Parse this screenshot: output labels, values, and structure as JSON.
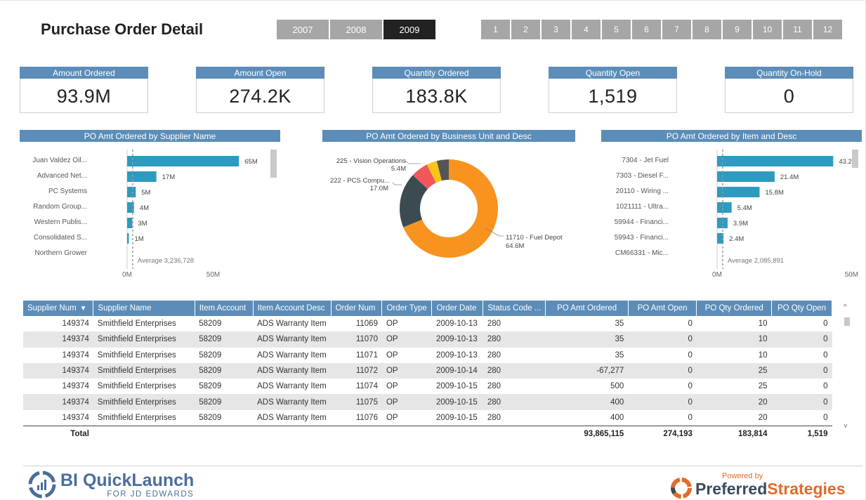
{
  "title": "Purchase Order Detail",
  "years": [
    {
      "label": "2007",
      "selected": false
    },
    {
      "label": "2008",
      "selected": false
    },
    {
      "label": "2009",
      "selected": true
    }
  ],
  "months": [
    "1",
    "2",
    "3",
    "4",
    "5",
    "6",
    "7",
    "8",
    "9",
    "10",
    "11",
    "12"
  ],
  "cards": [
    {
      "label": "Amount Ordered",
      "value": "93.9M"
    },
    {
      "label": "Amount Open",
      "value": "274.2K"
    },
    {
      "label": "Quantity Ordered",
      "value": "183.8K"
    },
    {
      "label": "Quantity Open",
      "value": "1,519"
    },
    {
      "label": "Quantity On-Hold",
      "value": "0"
    }
  ],
  "colors": {
    "header_blue": "#5b8db8",
    "bar_teal": "#2e9ac0",
    "donut_orange": "#f7931e",
    "donut_dark": "#3c4b52",
    "donut_red": "#f0565a",
    "donut_yellow": "#f5c518",
    "donut_grey": "#555555"
  },
  "chart_data": [
    {
      "type": "bar",
      "title": "PO Amt Ordered by Supplier Name",
      "orientation": "horizontal",
      "categories": [
        "Juan Valdez Oil...",
        "Advanced Net...",
        "PC Systems",
        "Random Group...",
        "Western Publis...",
        "Consolidated S...",
        "Northern Grower"
      ],
      "values": [
        65,
        17,
        5,
        4,
        3,
        1,
        0
      ],
      "value_labels": [
        "65M",
        "17M",
        "5M",
        "4M",
        "3M",
        "1M",
        ""
      ],
      "xticks": [
        "0M",
        "50M"
      ],
      "xlim": [
        0,
        80
      ],
      "average_label": "Average 3,236,728",
      "average_value": 3.236728
    },
    {
      "type": "pie",
      "title": "PO Amt Ordered by Business Unit and Desc",
      "slices": [
        {
          "label": "11710 - Fuel Depot",
          "value": 64.6,
          "value_label": "64.6M",
          "color": "#f7931e"
        },
        {
          "label": "222 - PCS Compu...",
          "value": 17.0,
          "value_label": "17.0M",
          "color": "#3c4b52"
        },
        {
          "label": "225 - Vision Operations",
          "value": 5.4,
          "value_label": "5.4M",
          "color": "#f0565a"
        },
        {
          "label": "",
          "value": 3.2,
          "color": "#f5c518"
        },
        {
          "label": "",
          "value": 3.7,
          "color": "#555555"
        }
      ]
    },
    {
      "type": "bar",
      "title": "PO Amt Ordered by Item and Desc",
      "orientation": "horizontal",
      "categories": [
        "7304 - Jet Fuel",
        "7303 - Diesel F...",
        "20110 - Wiring ...",
        "1021111 - Ultra...",
        "59944 - Financi...",
        "59943 - Financi...",
        "CM66331 - Mic..."
      ],
      "values": [
        43.2,
        21.4,
        15.8,
        5.4,
        3.9,
        2.4,
        0
      ],
      "value_labels": [
        "43.2M",
        "21.4M",
        "15.8M",
        "5.4M",
        "3.9M",
        "2.4M",
        ""
      ],
      "xticks": [
        "0M",
        "50M"
      ],
      "xlim": [
        0,
        52
      ],
      "average_label": "Average 2,085,891",
      "average_value": 2.085891
    }
  ],
  "table": {
    "columns": [
      "Supplier Num",
      "Supplier Name",
      "Item Account",
      "Item Account Desc",
      "Order Num",
      "Order Type",
      "Order Date",
      "Status Code ...",
      "PO Amt Ordered",
      "PO Amt Open",
      "PO Qty Ordered",
      "PO Qty Open"
    ],
    "sort_indicator": "▼",
    "rows": [
      [
        "149374",
        "Smithfield Enterprises",
        "58209",
        "ADS Warranty Item",
        "11069",
        "OP",
        "2009-10-13",
        "280",
        "35",
        "0",
        "10",
        "0"
      ],
      [
        "149374",
        "Smithfield Enterprises",
        "58209",
        "ADS Warranty Item",
        "11070",
        "OP",
        "2009-10-13",
        "280",
        "35",
        "0",
        "10",
        "0"
      ],
      [
        "149374",
        "Smithfield Enterprises",
        "58209",
        "ADS Warranty Item",
        "11071",
        "OP",
        "2009-10-13",
        "280",
        "35",
        "0",
        "10",
        "0"
      ],
      [
        "149374",
        "Smithfield Enterprises",
        "58209",
        "ADS Warranty Item",
        "11072",
        "OP",
        "2009-10-14",
        "280",
        "-67,277",
        "0",
        "25",
        "0"
      ],
      [
        "149374",
        "Smithfield Enterprises",
        "58209",
        "ADS Warranty Item",
        "11074",
        "OP",
        "2009-10-15",
        "280",
        "500",
        "0",
        "25",
        "0"
      ],
      [
        "149374",
        "Smithfield Enterprises",
        "58209",
        "ADS Warranty Item",
        "11075",
        "OP",
        "2009-10-15",
        "280",
        "400",
        "0",
        "20",
        "0"
      ],
      [
        "149374",
        "Smithfield Enterprises",
        "58209",
        "ADS Warranty Item",
        "11076",
        "OP",
        "2009-10-15",
        "280",
        "400",
        "0",
        "20",
        "0"
      ]
    ],
    "total": {
      "label": "Total",
      "po_amt_ordered": "93,865,115",
      "po_amt_open": "274,193",
      "po_qty_ordered": "183,814",
      "po_qty_open": "1,519"
    }
  },
  "footer": {
    "left_logo_main": "BI QuickLaunch",
    "left_logo_sub": "FOR JD EDWARDS",
    "right_logo_small": "Powered by",
    "right_logo_main_a": "Preferred",
    "right_logo_main_b": "Strategies"
  }
}
